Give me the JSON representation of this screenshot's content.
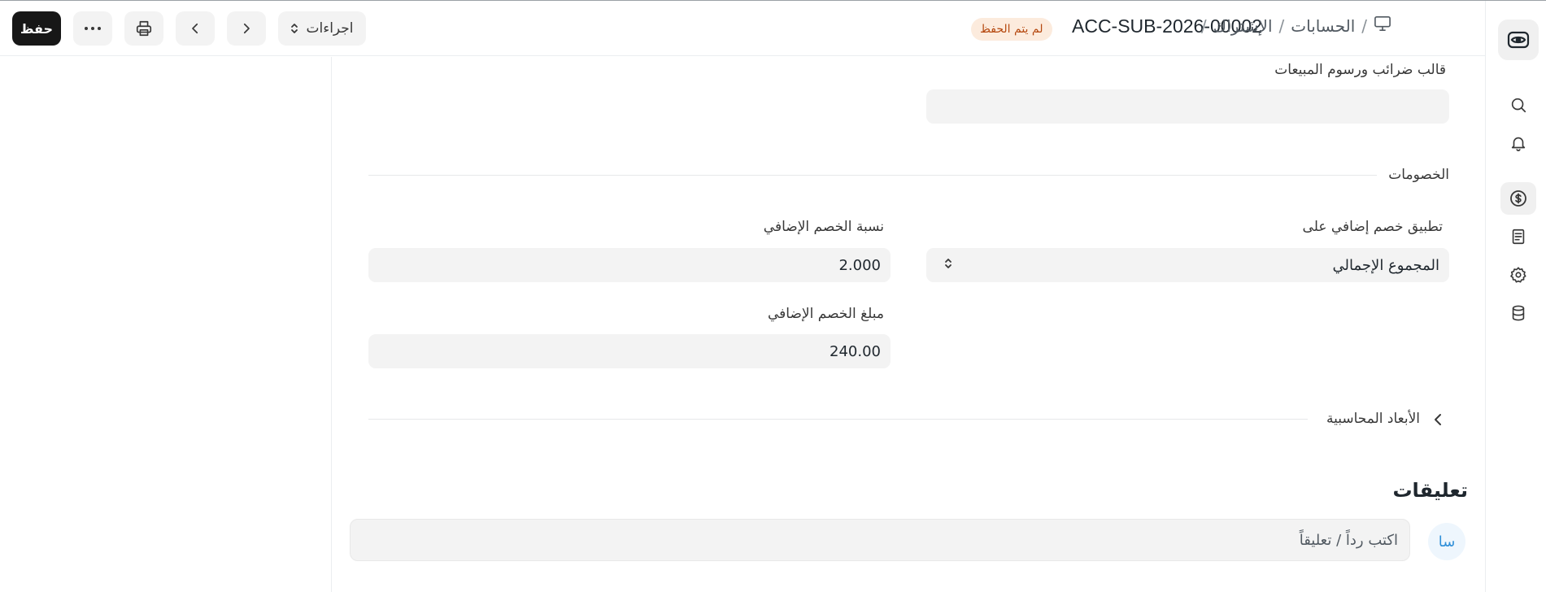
{
  "header": {
    "save_label": "حفظ",
    "actions_label": "اجراءات",
    "status_badge": "لم يتم الحفظ",
    "doc_title": "ACC-SUB-2026-00002",
    "breadcrumbs": [
      "الحسابات",
      "الإشتراك"
    ],
    "breadcrumb_sep": "/"
  },
  "form": {
    "tax_template_label": "قالب ضرائب ورسوم المبيعات",
    "tax_template_value": "",
    "discounts_section": "الخصومات",
    "apply_discount_label": "تطبيق خصم إضافي على",
    "apply_discount_value": "المجموع الإجمالي",
    "discount_percentage_label": "نسبة الخصم الإضافي",
    "discount_percentage_value": "2.000",
    "discount_amount_label": "مبلغ الخصم الإضافي",
    "discount_amount_value": "240.00",
    "dimensions_section": "الأبعاد المحاسبية"
  },
  "comments": {
    "title": "تعليقات",
    "placeholder": "اكتب رداً / تعليقاً",
    "avatar_initials": "سا"
  },
  "colors": {
    "primary_button": "#171717",
    "badge_bg": "#fcebdd",
    "badge_text": "#b5480f",
    "field_bg": "#f3f3f3"
  },
  "rail_icons": [
    "app-logo-icon",
    "search-icon",
    "bell-icon",
    "dollar-icon",
    "document-icon",
    "gear-icon",
    "database-icon"
  ]
}
